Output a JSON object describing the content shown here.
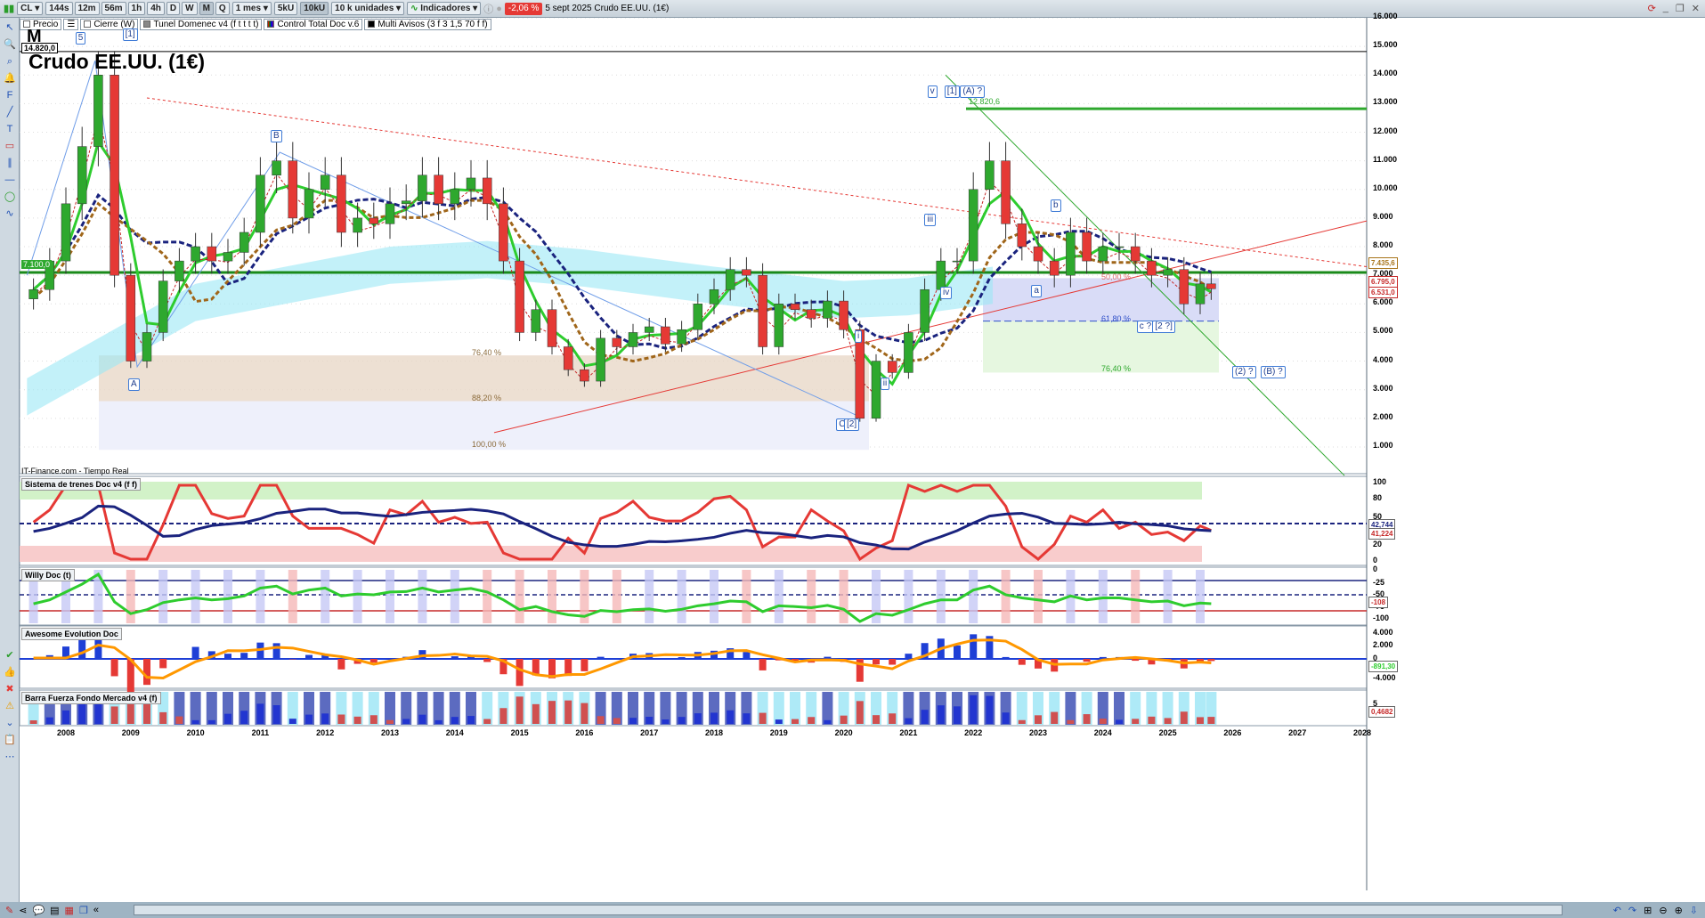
{
  "toolbar": {
    "symbol": "CL",
    "timeframes": [
      "144s",
      "12m",
      "56m",
      "1h",
      "4h",
      "D",
      "W",
      "M",
      "Q"
    ],
    "active_timeframe": "M",
    "period": "1 mes",
    "units_buttons": [
      "5kU",
      "10kU"
    ],
    "active_units": "10kU",
    "units": "10 k unidades",
    "indicators": "Indicadores",
    "change_pct": "-2,06 %",
    "date_title": "5 sept 2025 Crudo EE.UU. (1€)"
  },
  "legend": {
    "items": [
      "Precio",
      "Cierre (W)",
      "Tunel Domenec v4 (f t t t t)",
      "Control Total Doc v.6",
      "Multi Avisos (3 f 3 1,5 70 f f)"
    ]
  },
  "main": {
    "period_letter": "M",
    "title": "Crudo EE.UU. (1€)",
    "high_label": "14.820,0",
    "level_7100": "7.100,0",
    "level_12820": "12.820,6",
    "source": "IT-Finance.com - Tiempo Real",
    "waves": [
      "5",
      "[1]",
      "B",
      "A",
      "C",
      "[2]",
      "v",
      "[1]",
      "(A) ?",
      "iii",
      "iv",
      "i",
      "ii",
      "b",
      "a",
      "c ?",
      "[2 ?]",
      "(2) ?",
      "(B) ?"
    ],
    "fibs": [
      "76,40 %",
      "88,20 %",
      "100,00 %",
      "61,80 %",
      "76,40 %",
      "50,00 %"
    ]
  },
  "price_axis": {
    "ticks": [
      "16.000",
      "15.000",
      "14.000",
      "13.000",
      "12.000",
      "11.000",
      "10.000",
      "9.000",
      "8.000",
      "7.000",
      "6.000",
      "5.000",
      "4.000",
      "3.000",
      "2.000",
      "1.000"
    ],
    "markers": [
      {
        "value": "7.435,6",
        "color": "#a8741a"
      },
      {
        "value": "6.795,0",
        "color": "#c62828"
      },
      {
        "value": "6.531,0",
        "color": "#c62828"
      }
    ]
  },
  "panels": [
    {
      "name": "Sistema de trenes Doc v4 (f f)",
      "ticks": [
        "100",
        "80",
        "50",
        "20",
        "0"
      ],
      "readouts": [
        "42,744",
        "41,224"
      ]
    },
    {
      "name": "Willy Doc (t)",
      "ticks": [
        "0",
        "-25",
        "-50",
        "-75",
        "-100"
      ],
      "readouts": [
        "-108"
      ]
    },
    {
      "name": "Awesome Evolution Doc",
      "ticks": [
        "4.000",
        "2.000",
        "0",
        "-4.000"
      ],
      "readouts": [
        "-891,30"
      ]
    },
    {
      "name": "Barra Fuerza Fondo Mercado v4 (f)",
      "ticks": [
        "5"
      ],
      "readouts": [
        "0,4682"
      ]
    }
  ],
  "x_axis": {
    "years": [
      "2008",
      "2009",
      "2010",
      "2011",
      "2012",
      "2013",
      "2014",
      "2015",
      "2016",
      "2017",
      "2018",
      "2019",
      "2020",
      "2021",
      "2022",
      "2023",
      "2024",
      "2025",
      "2026",
      "2027",
      "2028"
    ]
  },
  "chart_data": {
    "type": "candlestick",
    "title": "Crudo EE.UU. (1€)",
    "timeframe": "monthly",
    "x": [
      2007.5,
      2007.75,
      2008,
      2008.25,
      2008.5,
      2008.75,
      2009,
      2009.25,
      2009.5,
      2009.75,
      2010,
      2010.25,
      2010.5,
      2010.75,
      2011,
      2011.25,
      2011.5,
      2011.75,
      2012,
      2012.25,
      2012.5,
      2012.75,
      2013,
      2013.25,
      2013.5,
      2013.75,
      2014,
      2014.25,
      2014.5,
      2014.75,
      2015,
      2015.25,
      2015.5,
      2015.75,
      2016,
      2016.25,
      2016.5,
      2016.75,
      2017,
      2017.25,
      2017.5,
      2017.75,
      2018,
      2018.25,
      2018.5,
      2018.75,
      2019,
      2019.25,
      2019.5,
      2019.75,
      2020,
      2020.25,
      2020.5,
      2020.75,
      2021,
      2021.25,
      2021.5,
      2021.75,
      2022,
      2022.25,
      2022.5,
      2022.75,
      2023,
      2023.25,
      2023.5,
      2023.75,
      2024,
      2024.25,
      2024.5,
      2024.75,
      2025,
      2025.25,
      2025.5,
      2025.67
    ],
    "close": [
      6500,
      7500,
      9500,
      11500,
      14000,
      7000,
      4000,
      5000,
      6800,
      7500,
      8000,
      7500,
      7800,
      8500,
      10500,
      11000,
      9000,
      10000,
      10500,
      8500,
      9000,
      8800,
      9500,
      9600,
      10500,
      9500,
      10000,
      10400,
      9500,
      7500,
      5000,
      5800,
      4500,
      3700,
      3300,
      4800,
      4500,
      5000,
      5200,
      4600,
      5100,
      6000,
      6500,
      7200,
      7000,
      4500,
      6000,
      5800,
      5500,
      6100,
      5100,
      2000,
      4000,
      3600,
      5000,
      6500,
      7500,
      7500,
      10000,
      11000,
      8800,
      8000,
      7500,
      7000,
      8500,
      7500,
      8000,
      8000,
      7500,
      7000,
      7200,
      6000,
      6700,
      6531
    ],
    "ylim": [
      0,
      16000
    ],
    "xlim": [
      2007.3,
      2028.2
    ]
  }
}
